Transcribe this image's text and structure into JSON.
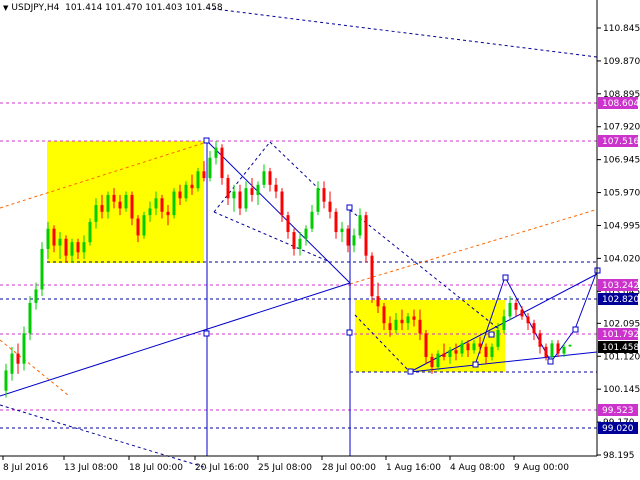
{
  "header": {
    "symbol_label": "USDJPY,H4",
    "ohlc": "101.414 101.470 101.403 101.458",
    "dropdown_icon": "triangle-down-icon"
  },
  "colors": {
    "bull": "#00cc00",
    "bear": "#ff0000",
    "zone": "#ffff00",
    "trend_line": "#0000cc",
    "level_magenta": "#cc33cc",
    "level_blue": "#000099",
    "orange_channel": "#ff6600",
    "price_marker": "#000000"
  },
  "chart_data": {
    "type": "candlestick",
    "title": "USDJPY,H4",
    "instrument": "USDJPY",
    "timeframe": "H4",
    "last_ohlc": {
      "open": 101.414,
      "high": 101.47,
      "low": 101.403,
      "close": 101.458
    },
    "ylim": [
      98.195,
      111.6
    ],
    "y_ticks": [
      "110.845",
      "109.870",
      "108.895",
      "107.920",
      "106.945",
      "105.970",
      "104.995",
      "104.020",
      "103.045",
      "102.095",
      "101.120",
      "100.145",
      "99.170",
      "98.195"
    ],
    "x_ticks": [
      "8 Jul 2016",
      "13 Jul 08:00",
      "18 Jul 00:00",
      "20 Jul 16:00",
      "25 Jul 08:00",
      "28 Jul 00:00",
      "1 Aug 16:00",
      "4 Aug 08:00",
      "9 Aug 00:00"
    ],
    "grid": false,
    "levels": [
      {
        "label": "108.604",
        "value": 108.604,
        "style": "magenta"
      },
      {
        "label": "107.516",
        "value": 107.516,
        "style": "magenta"
      },
      {
        "label": "103.242",
        "value": 103.242,
        "style": "magenta"
      },
      {
        "label": "102.820",
        "value": 102.82,
        "style": "blue"
      },
      {
        "label": "101.792",
        "value": 101.792,
        "style": "magenta"
      },
      {
        "label": "101.458",
        "value": 101.458,
        "style": "current"
      },
      {
        "label": "99.523",
        "value": 99.523,
        "style": "magenta"
      },
      {
        "label": "99.020",
        "value": 99.02,
        "style": "blue"
      }
    ],
    "candles": [
      {
        "o": 100.1,
        "h": 100.9,
        "l": 99.9,
        "c": 100.7
      },
      {
        "o": 100.6,
        "h": 101.4,
        "l": 100.4,
        "c": 101.2
      },
      {
        "o": 101.2,
        "h": 101.5,
        "l": 100.6,
        "c": 100.9
      },
      {
        "o": 100.9,
        "h": 102.0,
        "l": 100.7,
        "c": 101.8
      },
      {
        "o": 101.8,
        "h": 102.9,
        "l": 101.6,
        "c": 102.7
      },
      {
        "o": 102.7,
        "h": 103.3,
        "l": 102.5,
        "c": 103.1
      },
      {
        "o": 103.1,
        "h": 104.5,
        "l": 102.9,
        "c": 104.3
      },
      {
        "o": 104.3,
        "h": 105.1,
        "l": 104.0,
        "c": 104.9
      },
      {
        "o": 104.9,
        "h": 105.0,
        "l": 104.2,
        "c": 104.4
      },
      {
        "o": 104.4,
        "h": 104.8,
        "l": 104.0,
        "c": 104.6
      },
      {
        "o": 104.6,
        "h": 104.7,
        "l": 103.9,
        "c": 104.1
      },
      {
        "o": 104.1,
        "h": 104.6,
        "l": 103.9,
        "c": 104.5
      },
      {
        "o": 104.5,
        "h": 104.6,
        "l": 104.0,
        "c": 104.2
      },
      {
        "o": 104.2,
        "h": 104.7,
        "l": 104.0,
        "c": 104.5
      },
      {
        "o": 104.5,
        "h": 105.2,
        "l": 104.4,
        "c": 105.1
      },
      {
        "o": 105.1,
        "h": 105.8,
        "l": 104.9,
        "c": 105.6
      },
      {
        "o": 105.6,
        "h": 105.9,
        "l": 105.2,
        "c": 105.4
      },
      {
        "o": 105.4,
        "h": 106.0,
        "l": 105.2,
        "c": 105.9
      },
      {
        "o": 105.9,
        "h": 106.1,
        "l": 105.5,
        "c": 105.7
      },
      {
        "o": 105.7,
        "h": 105.9,
        "l": 105.3,
        "c": 105.5
      },
      {
        "o": 105.5,
        "h": 106.0,
        "l": 105.4,
        "c": 105.9
      },
      {
        "o": 105.9,
        "h": 106.0,
        "l": 105.0,
        "c": 105.2
      },
      {
        "o": 105.2,
        "h": 105.3,
        "l": 104.5,
        "c": 104.7
      },
      {
        "o": 104.7,
        "h": 105.4,
        "l": 104.6,
        "c": 105.3
      },
      {
        "o": 105.3,
        "h": 105.7,
        "l": 105.1,
        "c": 105.5
      },
      {
        "o": 105.5,
        "h": 106.0,
        "l": 105.3,
        "c": 105.8
      },
      {
        "o": 105.8,
        "h": 105.9,
        "l": 105.2,
        "c": 105.4
      },
      {
        "o": 105.4,
        "h": 105.6,
        "l": 105.0,
        "c": 105.3
      },
      {
        "o": 105.3,
        "h": 106.1,
        "l": 105.2,
        "c": 106.0
      },
      {
        "o": 106.0,
        "h": 106.2,
        "l": 105.6,
        "c": 105.8
      },
      {
        "o": 105.8,
        "h": 106.3,
        "l": 105.7,
        "c": 106.2
      },
      {
        "o": 106.2,
        "h": 106.5,
        "l": 105.9,
        "c": 106.1
      },
      {
        "o": 106.1,
        "h": 106.7,
        "l": 106.0,
        "c": 106.6
      },
      {
        "o": 106.6,
        "h": 106.9,
        "l": 106.3,
        "c": 106.4
      },
      {
        "o": 106.4,
        "h": 107.2,
        "l": 106.3,
        "c": 107.0
      },
      {
        "o": 107.0,
        "h": 107.5,
        "l": 106.8,
        "c": 107.3
      },
      {
        "o": 107.3,
        "h": 107.4,
        "l": 106.2,
        "c": 106.4
      },
      {
        "o": 106.4,
        "h": 106.5,
        "l": 105.6,
        "c": 105.8
      },
      {
        "o": 105.8,
        "h": 106.2,
        "l": 105.4,
        "c": 106.0
      },
      {
        "o": 106.0,
        "h": 106.2,
        "l": 105.3,
        "c": 105.5
      },
      {
        "o": 105.5,
        "h": 106.3,
        "l": 105.4,
        "c": 106.1
      },
      {
        "o": 106.1,
        "h": 106.4,
        "l": 105.7,
        "c": 105.9
      },
      {
        "o": 105.9,
        "h": 106.3,
        "l": 105.6,
        "c": 106.2
      },
      {
        "o": 106.2,
        "h": 106.8,
        "l": 106.1,
        "c": 106.6
      },
      {
        "o": 106.6,
        "h": 106.7,
        "l": 106.0,
        "c": 106.2
      },
      {
        "o": 106.2,
        "h": 106.4,
        "l": 105.8,
        "c": 106.0
      },
      {
        "o": 106.0,
        "h": 106.1,
        "l": 105.1,
        "c": 105.3
      },
      {
        "o": 105.3,
        "h": 105.4,
        "l": 104.6,
        "c": 104.8
      },
      {
        "o": 104.8,
        "h": 104.9,
        "l": 104.1,
        "c": 104.3
      },
      {
        "o": 104.3,
        "h": 104.8,
        "l": 104.1,
        "c": 104.6
      },
      {
        "o": 104.6,
        "h": 105.0,
        "l": 104.4,
        "c": 104.9
      },
      {
        "o": 104.9,
        "h": 105.6,
        "l": 104.8,
        "c": 105.4
      },
      {
        "o": 105.4,
        "h": 106.3,
        "l": 105.3,
        "c": 106.1
      },
      {
        "o": 106.1,
        "h": 106.3,
        "l": 105.5,
        "c": 105.7
      },
      {
        "o": 105.7,
        "h": 106.0,
        "l": 105.2,
        "c": 105.4
      },
      {
        "o": 105.4,
        "h": 105.5,
        "l": 104.6,
        "c": 104.8
      },
      {
        "o": 104.8,
        "h": 105.1,
        "l": 104.5,
        "c": 104.9
      },
      {
        "o": 104.9,
        "h": 105.0,
        "l": 104.2,
        "c": 104.4
      },
      {
        "o": 104.4,
        "h": 104.9,
        "l": 104.2,
        "c": 104.7
      },
      {
        "o": 104.7,
        "h": 105.5,
        "l": 104.6,
        "c": 105.3
      },
      {
        "o": 105.3,
        "h": 105.4,
        "l": 103.9,
        "c": 104.1
      },
      {
        "o": 104.1,
        "h": 104.2,
        "l": 102.7,
        "c": 102.9
      },
      {
        "o": 102.9,
        "h": 103.3,
        "l": 102.4,
        "c": 102.6
      },
      {
        "o": 102.6,
        "h": 102.7,
        "l": 101.9,
        "c": 102.1
      },
      {
        "o": 102.1,
        "h": 102.3,
        "l": 101.7,
        "c": 101.9
      },
      {
        "o": 101.9,
        "h": 102.4,
        "l": 101.8,
        "c": 102.2
      },
      {
        "o": 102.2,
        "h": 102.5,
        "l": 101.9,
        "c": 102.1
      },
      {
        "o": 102.1,
        "h": 102.4,
        "l": 101.9,
        "c": 102.3
      },
      {
        "o": 102.3,
        "h": 102.5,
        "l": 102.0,
        "c": 102.2
      },
      {
        "o": 102.2,
        "h": 102.5,
        "l": 101.6,
        "c": 101.8
      },
      {
        "o": 101.8,
        "h": 101.9,
        "l": 100.9,
        "c": 101.1
      },
      {
        "o": 101.1,
        "h": 101.2,
        "l": 100.6,
        "c": 100.8
      },
      {
        "o": 100.8,
        "h": 101.3,
        "l": 100.7,
        "c": 101.2
      },
      {
        "o": 101.2,
        "h": 101.5,
        "l": 101.0,
        "c": 101.1
      },
      {
        "o": 101.1,
        "h": 101.4,
        "l": 100.9,
        "c": 101.3
      },
      {
        "o": 101.3,
        "h": 101.5,
        "l": 101.0,
        "c": 101.2
      },
      {
        "o": 101.2,
        "h": 101.6,
        "l": 101.1,
        "c": 101.5
      },
      {
        "o": 101.5,
        "h": 101.6,
        "l": 101.1,
        "c": 101.3
      },
      {
        "o": 101.3,
        "h": 101.6,
        "l": 101.2,
        "c": 101.5
      },
      {
        "o": 101.5,
        "h": 101.7,
        "l": 101.2,
        "c": 101.4
      },
      {
        "o": 101.4,
        "h": 101.5,
        "l": 100.9,
        "c": 101.1
      },
      {
        "o": 101.1,
        "h": 101.5,
        "l": 101.0,
        "c": 101.4
      },
      {
        "o": 101.4,
        "h": 102.1,
        "l": 101.3,
        "c": 101.9
      },
      {
        "o": 101.9,
        "h": 102.5,
        "l": 101.8,
        "c": 102.3
      },
      {
        "o": 102.3,
        "h": 102.9,
        "l": 102.2,
        "c": 102.7
      },
      {
        "o": 102.7,
        "h": 102.8,
        "l": 102.3,
        "c": 102.5
      },
      {
        "o": 102.5,
        "h": 102.6,
        "l": 102.2,
        "c": 102.3
      },
      {
        "o": 102.3,
        "h": 102.4,
        "l": 101.9,
        "c": 102.1
      },
      {
        "o": 102.1,
        "h": 102.2,
        "l": 101.6,
        "c": 101.8
      },
      {
        "o": 101.8,
        "h": 101.9,
        "l": 101.2,
        "c": 101.4
      },
      {
        "o": 101.4,
        "h": 101.5,
        "l": 101.0,
        "c": 101.1
      },
      {
        "o": 101.1,
        "h": 101.6,
        "l": 101.0,
        "c": 101.5
      },
      {
        "o": 101.5,
        "h": 101.6,
        "l": 101.1,
        "c": 101.2
      },
      {
        "o": 101.2,
        "h": 101.5,
        "l": 101.1,
        "c": 101.4
      },
      {
        "o": 101.414,
        "h": 101.47,
        "l": 101.403,
        "c": 101.458
      }
    ]
  }
}
